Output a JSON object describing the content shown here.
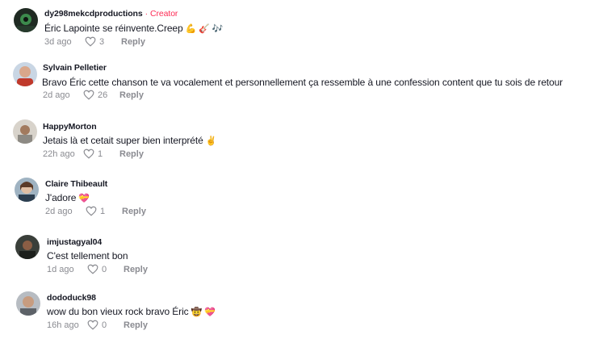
{
  "comments": [
    {
      "username": "dy298mekcdproductions",
      "creator_separator": "·",
      "creator_label": "Creator",
      "text": "Éric Lapointe se réinvente.Creep",
      "emojis": "💪 🎸 🎶",
      "time": "3d ago",
      "likes": "3",
      "reply_label": "Reply"
    },
    {
      "username": "Sylvain Pelletier",
      "text": "Bravo Éric cette chanson te va vocalement et personnellement ça ressemble à une confession content que tu sois de retour",
      "time": "2d ago",
      "likes": "26",
      "reply_label": "Reply"
    },
    {
      "username": "HappyMorton",
      "text": "Jetais là et cetait super bien interprété",
      "emojis": "✌️",
      "time": "22h ago",
      "likes": "1",
      "reply_label": "Reply"
    },
    {
      "username": "Claire Thibeault",
      "text": "J'adore",
      "emojis": "💝",
      "time": "2d ago",
      "likes": "1",
      "reply_label": "Reply"
    },
    {
      "username": "imjustagyal04",
      "text": "C'est tellement bon",
      "time": "1d ago",
      "likes": "0",
      "reply_label": "Reply"
    },
    {
      "username": "dododuck98",
      "text": "wow du bon vieux rock bravo Éric",
      "emojis": "🤠 💝",
      "time": "16h ago",
      "likes": "0",
      "reply_label": "Reply"
    }
  ],
  "colors": {
    "creator_accent": "#fe2c55",
    "text": "#161823",
    "meta": "#8a8b91"
  }
}
